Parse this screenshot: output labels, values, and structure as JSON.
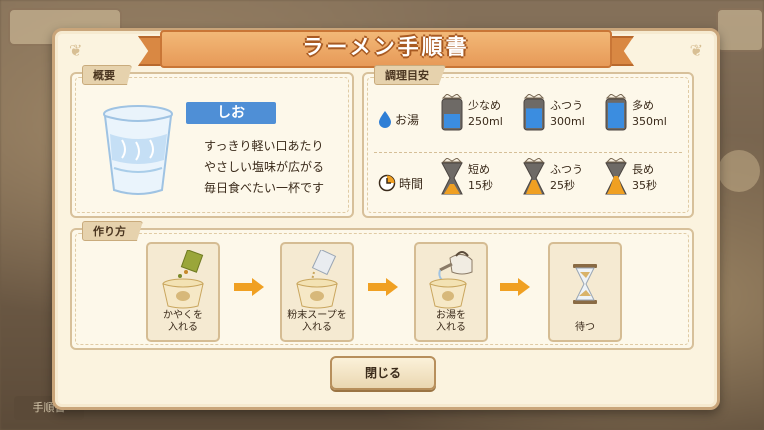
{
  "title": "ラーメン手順書",
  "background": {
    "handbook_label": "手順書"
  },
  "overview": {
    "label": "概要",
    "flavor": "しお",
    "flavor_color": "#4f8fd6",
    "description": [
      "すっきり軽い口あたり",
      "やさしい塩味が広がる",
      "毎日食べたい一杯です"
    ]
  },
  "guide": {
    "label": "調理目安",
    "water": {
      "label": "お湯",
      "icon": "water-drop-icon",
      "options": [
        {
          "name": "少なめ",
          "value": "250ml",
          "fill": 0.5
        },
        {
          "name": "ふつう",
          "value": "300ml",
          "fill": 0.7
        },
        {
          "name": "多め",
          "value": "350ml",
          "fill": 0.9
        }
      ],
      "color": "#3b8de0"
    },
    "time": {
      "label": "時間",
      "icon": "clock-icon",
      "options": [
        {
          "name": "短め",
          "value": "15秒"
        },
        {
          "name": "ふつう",
          "value": "25秒"
        },
        {
          "name": "長め",
          "value": "35秒"
        }
      ],
      "color": "#f0a022"
    }
  },
  "howto": {
    "label": "作り方",
    "steps": [
      {
        "caption": [
          "かやくを",
          "入れる"
        ],
        "icon": "add-toppings-icon"
      },
      {
        "caption": [
          "粉末スープを",
          "入れる"
        ],
        "icon": "add-soup-powder-icon"
      },
      {
        "caption": [
          "お湯を",
          "入れる"
        ],
        "icon": "pour-hot-water-icon"
      },
      {
        "caption": [
          "待つ"
        ],
        "icon": "hourglass-icon"
      }
    ]
  },
  "close_label": "閉じる"
}
